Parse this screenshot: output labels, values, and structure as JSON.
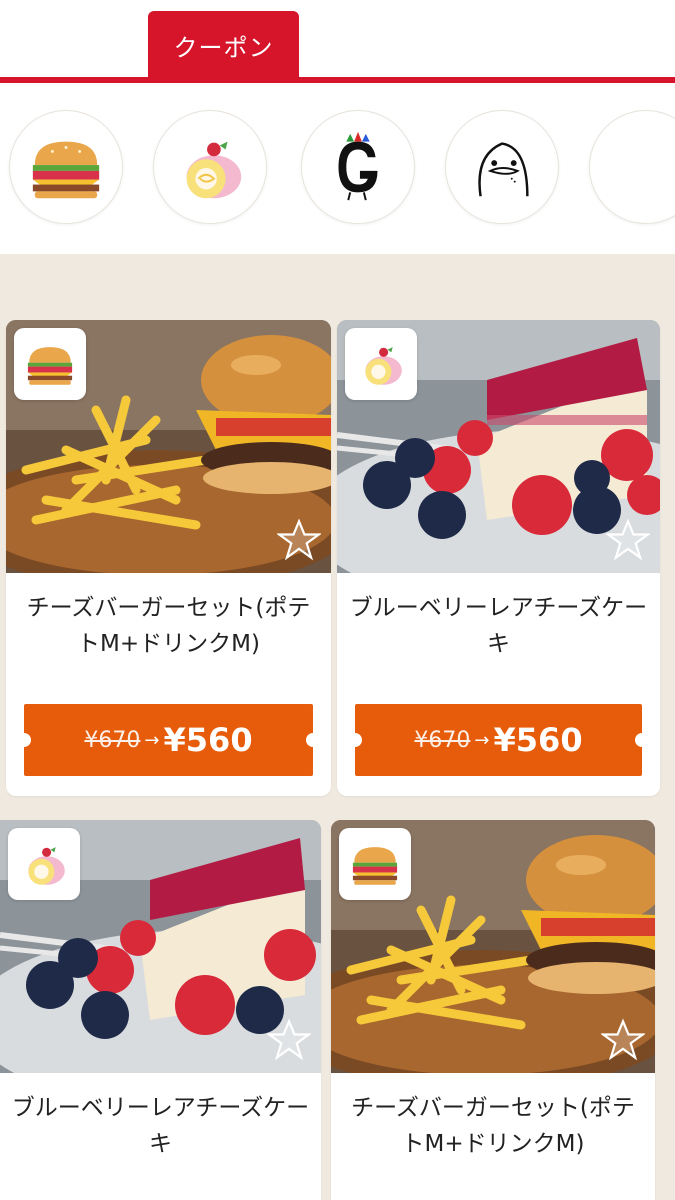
{
  "tab": {
    "label": "クーポン"
  },
  "colors": {
    "accent": "#d6152b",
    "price_button": "#e65c0a",
    "background": "#efe9df"
  },
  "categories": [
    {
      "name": "burger"
    },
    {
      "name": "cake-roll"
    },
    {
      "name": "g-monster"
    },
    {
      "name": "white-bird"
    },
    {
      "name": "partial-circle"
    }
  ],
  "cards": [
    {
      "title": "チーズバーガーセット(ポテトM+ドリンクM)",
      "old_price": "¥670",
      "new_price": "¥560",
      "badge_icon": "burger-icon",
      "image": "burger-and-fries"
    },
    {
      "title": "ブルーベリーレアチーズケーキ",
      "old_price": "¥670",
      "new_price": "¥560",
      "badge_icon": "cake-roll-icon",
      "image": "berry-cheesecake"
    },
    {
      "title": "ブルーベリーレアチーズケーキ",
      "badge_icon": "cake-roll-icon",
      "image": "berry-cheesecake"
    },
    {
      "title": "チーズバーガーセット(ポテトM+ドリンクM)",
      "badge_icon": "burger-icon",
      "image": "burger-and-fries"
    }
  ]
}
